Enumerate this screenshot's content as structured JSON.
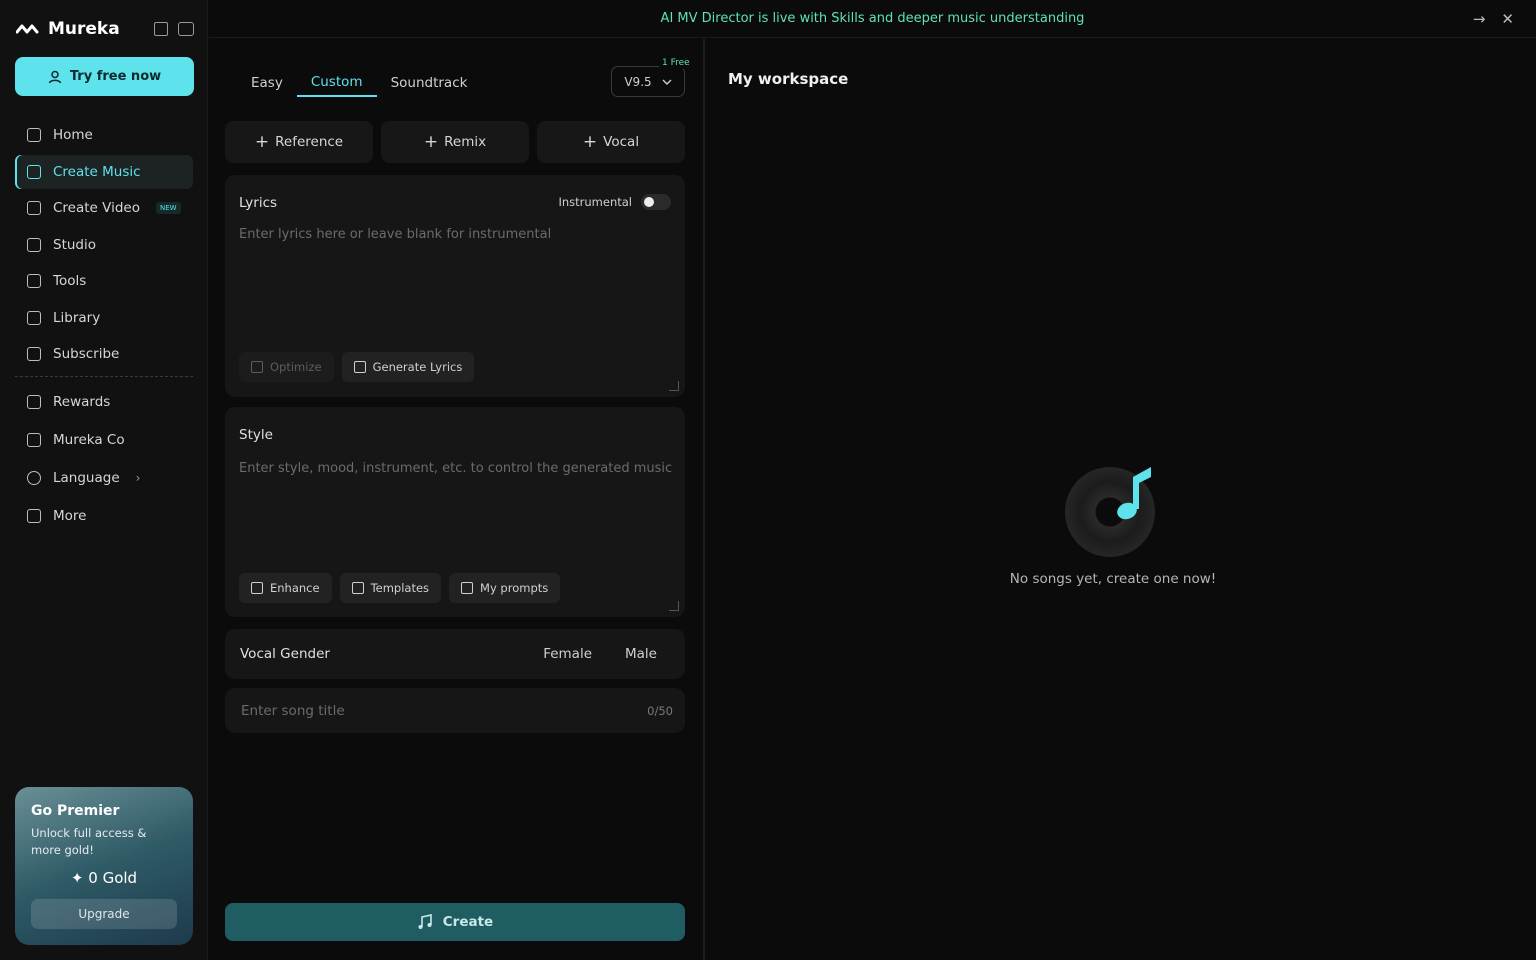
{
  "brand": {
    "name": "Mureka"
  },
  "sidebar": {
    "try_label": "Try free now",
    "nav": [
      {
        "label": "Home",
        "icon": "home-icon"
      },
      {
        "label": "Create Music",
        "icon": "music-note-icon",
        "active": true
      },
      {
        "label": "Create Video",
        "icon": "video-icon",
        "badge": "NEW"
      },
      {
        "label": "Studio",
        "icon": "waveform-icon"
      },
      {
        "label": "Tools",
        "icon": "tools-icon"
      },
      {
        "label": "Library",
        "icon": "library-icon"
      },
      {
        "label": "Subscribe",
        "icon": "database-icon"
      }
    ],
    "nav2": [
      {
        "label": "Rewards",
        "icon": "trophy-icon"
      },
      {
        "label": "Mureka Co",
        "icon": "monitor-icon"
      },
      {
        "label": "Language",
        "icon": "globe-icon",
        "chevron": "›"
      },
      {
        "label": "More",
        "icon": "grid-icon"
      }
    ],
    "premier": {
      "title": "Go Premier",
      "subtitle": "Unlock full access & more gold!",
      "gold": "0 Gold",
      "upgrade": "Upgrade"
    }
  },
  "banner": {
    "text": "AI MV Director is live with Skills and deeper music understanding"
  },
  "create": {
    "tabs": [
      "Easy",
      "Custom",
      "Soundtrack"
    ],
    "active_tab": "Custom",
    "version": "V9.5",
    "free_tag": "1 Free",
    "chips": [
      "Reference",
      "Remix",
      "Vocal"
    ],
    "lyrics": {
      "title": "Lyrics",
      "placeholder": "Enter lyrics here or leave blank for instrumental",
      "instrumental": "Instrumental",
      "optimize": "Optimize",
      "generate": "Generate Lyrics"
    },
    "style": {
      "title": "Style",
      "placeholder": "Enter style, mood, instrument, etc. to control the generated music",
      "enhance": "Enhance",
      "templates": "Templates",
      "prompts": "My prompts"
    },
    "gender": {
      "label": "Vocal Gender",
      "female": "Female",
      "male": "Male"
    },
    "song_title": {
      "placeholder": "Enter song title",
      "counter": "0/50"
    },
    "create_label": "Create"
  },
  "workspace": {
    "title": "My workspace",
    "empty_text": "No songs yet, create one now!"
  },
  "colors": {
    "accent": "#5ee3ec",
    "banner": "#5ee3b0",
    "create_button": "#1f5d62"
  }
}
